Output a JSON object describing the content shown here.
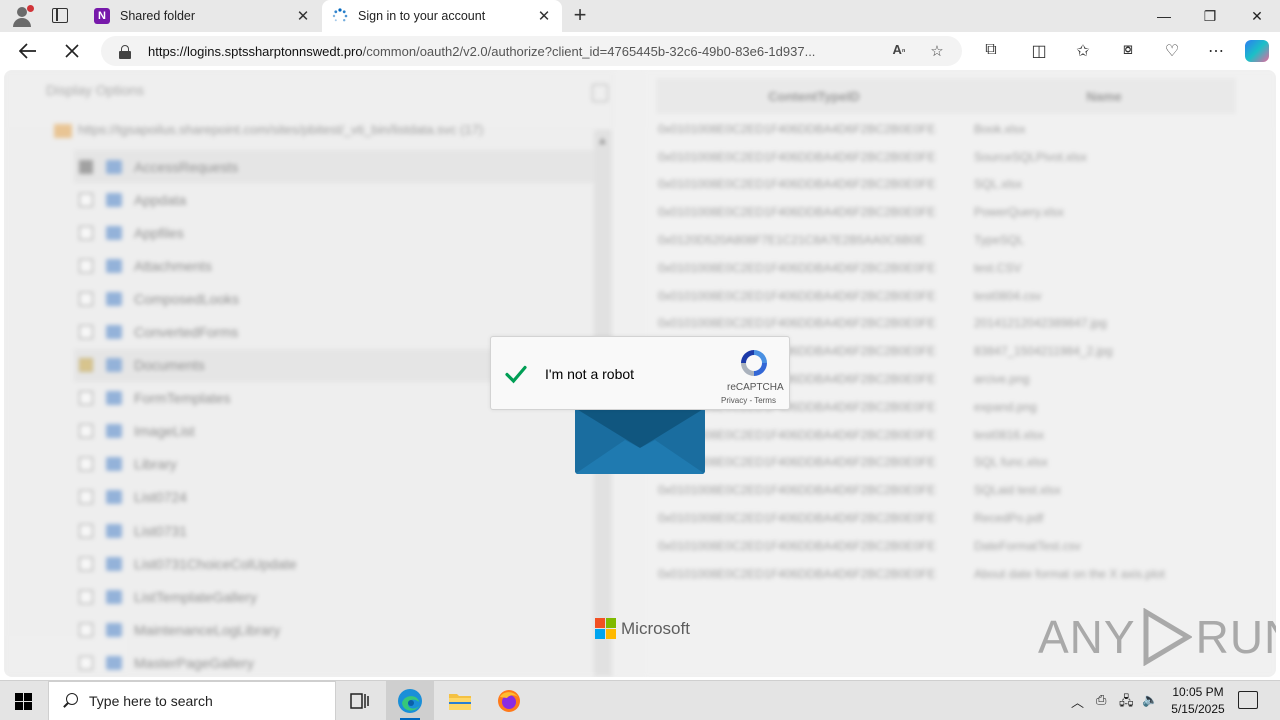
{
  "browser": {
    "tabs": [
      {
        "title": "Shared folder",
        "favicon": "onenote-icon",
        "favicon_letter": "N",
        "active": false
      },
      {
        "title": "Sign in to your account",
        "favicon": "loading-spinner-icon",
        "active": true
      }
    ],
    "url_host": "https://logins.sptssharptonnswedt.pro",
    "url_path": "/common/oauth2/v2.0/authorize?client_id=4765445b-32c6-49b0-83e6-1d937..."
  },
  "background": {
    "display_options": "Display Options",
    "root_path": "https://tgsapoilus.sharepoint.com/sites/pbitest/_vti_bin/listdata.svc (17)",
    "lists": [
      {
        "label": "AccessRequests",
        "state": "half",
        "selected": true
      },
      {
        "label": "Appdata",
        "state": "none"
      },
      {
        "label": "Appfiles",
        "state": "none"
      },
      {
        "label": "Attachments",
        "state": "none"
      },
      {
        "label": "ComposedLooks",
        "state": "none"
      },
      {
        "label": "ConvertedForms",
        "state": "none"
      },
      {
        "label": "Documents",
        "state": "checked",
        "selected": true
      },
      {
        "label": "FormTemplates",
        "state": "none"
      },
      {
        "label": "ImageList",
        "state": "none"
      },
      {
        "label": "Library",
        "state": "none"
      },
      {
        "label": "List0724",
        "state": "none"
      },
      {
        "label": "List0731",
        "state": "none"
      },
      {
        "label": "List0731ChoiceColUpdate",
        "state": "none"
      },
      {
        "label": "ListTemplateGallery",
        "state": "none"
      },
      {
        "label": "MaintenanceLogLibrary",
        "state": "none"
      },
      {
        "label": "MasterPageGallery",
        "state": "none"
      }
    ],
    "grid_headers": [
      "ContentTypeID",
      "Name"
    ],
    "grid_rows": [
      {
        "ct": "0x0101008E0C2ED1F406DDBA4D6F2BC2B0E0FE",
        "name": "Book.xlsx"
      },
      {
        "ct": "0x0101008E0C2ED1F406DDBA4D6F2BC2B0E0FE",
        "name": "SourceSQLPivot.xlsx"
      },
      {
        "ct": "0x0101008E0C2ED1F406DDBA4D6F2BC2B0E0FE",
        "name": "SQL.xlsx"
      },
      {
        "ct": "0x0101008E0C2ED1F406DDBA4D6F2BC2B0E0FE",
        "name": "PowerQuery.xlsx"
      },
      {
        "ct": "0x0120D520A808F7E1C21C8A7E2B5AA0C6B0E",
        "name": "TypeSQL"
      },
      {
        "ct": "0x0101008E0C2ED1F406DDBA4D6F2BC2B0E0FE",
        "name": "test.CSV"
      },
      {
        "ct": "0x0101008E0C2ED1F406DDBA4D6F2BC2B0E0FE",
        "name": "test0804.csv"
      },
      {
        "ct": "0x0101008E0C2ED1F406DDBA4D6F2BC2B0E0FE",
        "name": "20141212042389847.jpg"
      },
      {
        "ct": "0x0101008E0C2ED1F406DDBA4D6F2BC2B0E0FE",
        "name": "83847_1504211984_2.jpg"
      },
      {
        "ct": "0x0101008E0C2ED1F406DDBA4D6F2BC2B0E0FE",
        "name": "arcive.png"
      },
      {
        "ct": "0x0101008E0C2ED1F406DDBA4D6F2BC2B0E0FE",
        "name": "expand.png"
      },
      {
        "ct": "0x0101008E0C2ED1F406DDBA4D6F2BC2B0E0FE",
        "name": "test0816.xlsx"
      },
      {
        "ct": "0x0101008E0C2ED1F406DDBA4D6F2BC2B0E0FE",
        "name": "SQL func.xlsx"
      },
      {
        "ct": "0x0101008E0C2ED1F406DDBA4D6F2BC2B0E0FE",
        "name": "SQLaid test.xlsx"
      },
      {
        "ct": "0x0101008E0C2ED1F406DDBA4D6F2BC2B0E0FE",
        "name": "RecedPo.pdf"
      },
      {
        "ct": "0x0101008E0C2ED1F406DDBA4D6F2BC2B0E0FE",
        "name": "DateFormatTest.csv"
      },
      {
        "ct": "0x0101008E0C2ED1F406DDBA4D6F2BC2B0E0FE",
        "name": "About date format on the X axis.plot"
      }
    ]
  },
  "overlay": {
    "captcha_label": "I'm not a robot",
    "captcha_brand": "reCAPTCHA",
    "captcha_links": "Privacy - Terms",
    "microsoft_label": "Microsoft",
    "ms_colors": [
      "#f25022",
      "#7fba00",
      "#00a4ef",
      "#ffb900"
    ],
    "watermark_left": "ANY",
    "watermark_right": "RUN"
  },
  "taskbar": {
    "search_placeholder": "Type here to search",
    "time": "10:05 PM",
    "date": "5/15/2025"
  }
}
